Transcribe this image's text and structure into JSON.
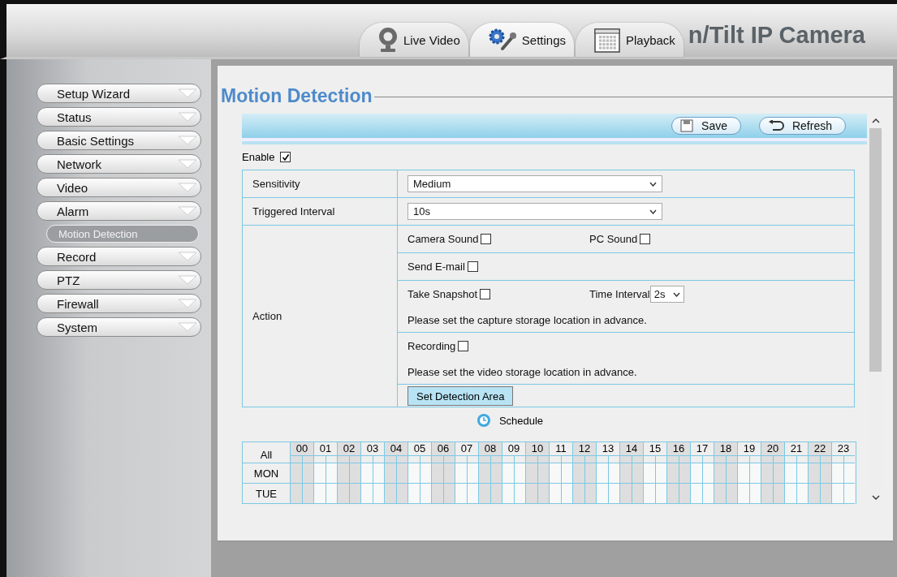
{
  "header": {
    "tabs": [
      {
        "label": "Live Video",
        "kind": "webcam",
        "selected": false
      },
      {
        "label": "Settings",
        "kind": "gears",
        "selected": true
      },
      {
        "label": "Playback",
        "kind": "calendar",
        "selected": false
      }
    ],
    "title": "n/Tilt IP Camera"
  },
  "sidebar": {
    "items": [
      {
        "label": "Setup Wizard",
        "selected": false
      },
      {
        "label": "Status",
        "selected": false
      },
      {
        "label": "Basic Settings",
        "selected": false
      },
      {
        "label": "Network",
        "selected": false
      },
      {
        "label": "Video",
        "selected": false
      },
      {
        "label": "Alarm",
        "selected": false,
        "children": [
          {
            "label": "Motion Detection",
            "selected": true
          }
        ]
      },
      {
        "label": "Record",
        "selected": false
      },
      {
        "label": "PTZ",
        "selected": false
      },
      {
        "label": "Firewall",
        "selected": false
      },
      {
        "label": "System",
        "selected": false
      }
    ]
  },
  "panel": {
    "title": "Motion Detection",
    "toolbar": [
      {
        "label": "Save",
        "kind": "save"
      },
      {
        "label": "Refresh",
        "kind": "refresh"
      }
    ],
    "enable": {
      "label": "Enable",
      "checked": true
    },
    "sensitivity": {
      "label": "Sensitivity",
      "value": "Medium"
    },
    "triggered_interval": {
      "label": "Triggered Interval",
      "value": "10s"
    },
    "action": {
      "label": "Action",
      "camera_sound": {
        "label": "Camera Sound",
        "checked": false
      },
      "pc_sound": {
        "label": "PC Sound",
        "checked": false
      },
      "send_email": {
        "label": "Send E-mail",
        "checked": false
      },
      "take_snapshot": {
        "label": "Take Snapshot",
        "checked": false
      },
      "time_interval": {
        "label": "Time Interval",
        "value": "2s"
      },
      "snapshot_note": "Please set the capture storage location in advance.",
      "recording": {
        "label": "Recording",
        "checked": false
      },
      "recording_note": "Please set the video storage location in advance.",
      "detection_area_button": "Set Detection Area"
    },
    "schedule": {
      "label": "Schedule",
      "hours": [
        "00",
        "01",
        "02",
        "03",
        "04",
        "05",
        "06",
        "07",
        "08",
        "09",
        "10",
        "11",
        "12",
        "13",
        "14",
        "15",
        "16",
        "17",
        "18",
        "19",
        "20",
        "21",
        "22",
        "23"
      ],
      "corner": "All",
      "days": [
        "MON",
        "TUE"
      ]
    }
  }
}
